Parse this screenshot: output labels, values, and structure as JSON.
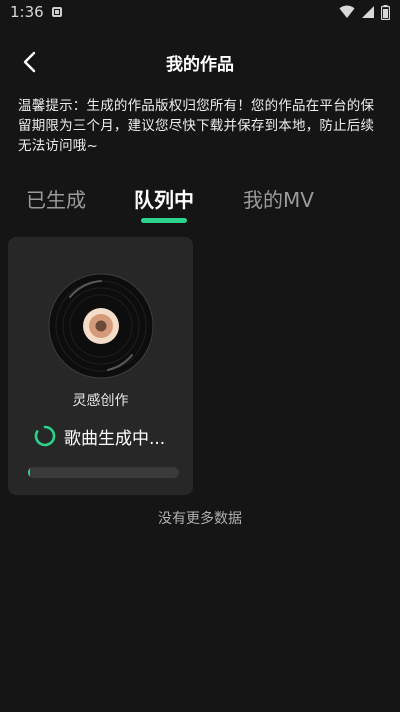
{
  "status_bar": {
    "time": "1:36"
  },
  "header": {
    "title": "我的作品"
  },
  "notice": {
    "text": "温馨提示：生成的作品版权归您所有！您的作品在平台的保留期限为三个月，建议您尽快下载并保存到本地，防止后续无法访问哦~"
  },
  "tabs": [
    {
      "label": "已生成",
      "active": false
    },
    {
      "label": "队列中",
      "active": true
    },
    {
      "label": "我的MV",
      "active": false
    }
  ],
  "card": {
    "name": "灵感创作",
    "status": "歌曲生成中...",
    "progress": 0.01
  },
  "footer": {
    "no_more": "没有更多数据"
  },
  "colors": {
    "accent": "#2bd48a",
    "background": "#151515",
    "card": "#272727"
  },
  "icons": [
    "back-arrow-icon",
    "wifi-icon",
    "signal-icon",
    "battery-icon",
    "notification-icon",
    "vinyl-record-icon",
    "loading-spinner-icon"
  ]
}
